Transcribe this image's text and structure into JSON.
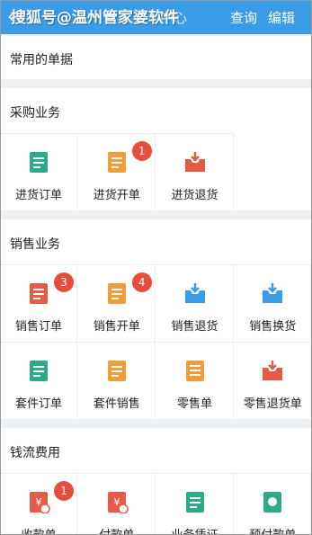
{
  "header": {
    "back_icon": "back-arrow-icon",
    "watermark": "搜狐号@温州管家婆软件",
    "title_partial": "中心",
    "query_label": "查询",
    "edit_label": "编辑"
  },
  "sections": {
    "common": {
      "title": "常用的单据"
    },
    "purchase": {
      "title": "采购业务",
      "items": [
        {
          "label": "进货订单",
          "icon": "purchase-order-icon",
          "color": "#2daa8a"
        },
        {
          "label": "进货开单",
          "icon": "purchase-invoice-icon",
          "color": "#f29d38",
          "badge": "1"
        },
        {
          "label": "进货退货",
          "icon": "purchase-return-icon",
          "color": "#e55b48"
        }
      ]
    },
    "sales": {
      "title": "销售业务",
      "items": [
        {
          "label": "销售订单",
          "icon": "sales-order-icon",
          "color": "#e55b48",
          "badge": "3"
        },
        {
          "label": "销售开单",
          "icon": "sales-invoice-icon",
          "color": "#f29d38",
          "badge": "4"
        },
        {
          "label": "销售退货",
          "icon": "sales-return-icon",
          "color": "#3a9be6"
        },
        {
          "label": "销售换货",
          "icon": "sales-exchange-icon",
          "color": "#3a9be6"
        },
        {
          "label": "套件订单",
          "icon": "kit-order-icon",
          "color": "#2daa8a"
        },
        {
          "label": "套件销售",
          "icon": "kit-sales-icon",
          "color": "#f29d38"
        },
        {
          "label": "零售单",
          "icon": "retail-receipt-icon",
          "color": "#f29d38"
        },
        {
          "label": "零售退货单",
          "icon": "retail-return-icon",
          "color": "#e55b48"
        }
      ]
    },
    "cashflow": {
      "title": "钱流费用",
      "items": [
        {
          "label": "收款单",
          "icon": "receipt-icon",
          "color": "#e55b48",
          "badge": "1"
        },
        {
          "label": "付款单",
          "icon": "payment-icon",
          "color": "#e55b48"
        },
        {
          "label": "业务凭证",
          "icon": "voucher-icon",
          "color": "#2daa8a"
        },
        {
          "label": "预付款单",
          "icon": "prepayment-icon",
          "color": "#2daa8a"
        }
      ]
    }
  }
}
